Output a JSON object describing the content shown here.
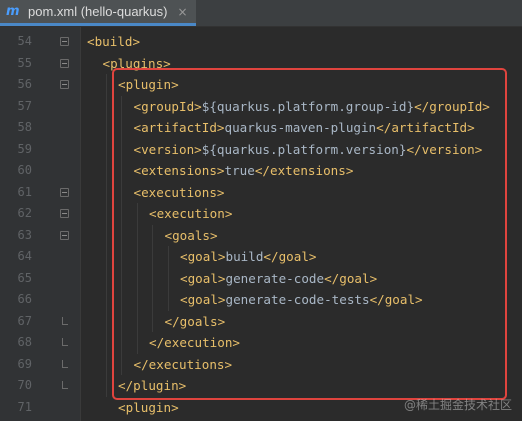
{
  "tab": {
    "icon": "maven-icon",
    "label": "pom.xml (hello-quarkus)",
    "close": "×"
  },
  "lines": [
    {
      "num": "54",
      "indent": 0,
      "parts": [
        [
          "tag",
          "<build>"
        ]
      ]
    },
    {
      "num": "55",
      "indent": 1,
      "parts": [
        [
          "tag",
          "<plugins>"
        ]
      ]
    },
    {
      "num": "56",
      "indent": 2,
      "parts": [
        [
          "tag",
          "<plugin>"
        ]
      ]
    },
    {
      "num": "57",
      "indent": 3,
      "parts": [
        [
          "tag",
          "<groupId>"
        ],
        [
          "txt",
          "${quarkus.platform.group-id}"
        ],
        [
          "tag",
          "</groupId>"
        ]
      ]
    },
    {
      "num": "58",
      "indent": 3,
      "parts": [
        [
          "tag",
          "<artifactId>"
        ],
        [
          "txt",
          "quarkus-maven-plugin"
        ],
        [
          "tag",
          "</artifactId>"
        ]
      ]
    },
    {
      "num": "59",
      "indent": 3,
      "parts": [
        [
          "tag",
          "<version>"
        ],
        [
          "txt",
          "${quarkus.platform.version}"
        ],
        [
          "tag",
          "</version>"
        ]
      ]
    },
    {
      "num": "60",
      "indent": 3,
      "parts": [
        [
          "tag",
          "<extensions>"
        ],
        [
          "txt",
          "true"
        ],
        [
          "tag",
          "</extensions>"
        ]
      ]
    },
    {
      "num": "61",
      "indent": 3,
      "parts": [
        [
          "tag",
          "<executions>"
        ]
      ]
    },
    {
      "num": "62",
      "indent": 4,
      "parts": [
        [
          "tag",
          "<execution>"
        ]
      ]
    },
    {
      "num": "63",
      "indent": 5,
      "parts": [
        [
          "tag",
          "<goals>"
        ]
      ]
    },
    {
      "num": "64",
      "indent": 6,
      "parts": [
        [
          "tag",
          "<goal>"
        ],
        [
          "txt",
          "build"
        ],
        [
          "tag",
          "</goal>"
        ]
      ]
    },
    {
      "num": "65",
      "indent": 6,
      "parts": [
        [
          "tag",
          "<goal>"
        ],
        [
          "txt",
          "generate-code"
        ],
        [
          "tag",
          "</goal>"
        ]
      ]
    },
    {
      "num": "66",
      "indent": 6,
      "parts": [
        [
          "tag",
          "<goal>"
        ],
        [
          "txt",
          "generate-code-tests"
        ],
        [
          "tag",
          "</goal>"
        ]
      ]
    },
    {
      "num": "67",
      "indent": 5,
      "parts": [
        [
          "tag",
          "</goals>"
        ]
      ]
    },
    {
      "num": "68",
      "indent": 4,
      "parts": [
        [
          "tag",
          "</execution>"
        ]
      ]
    },
    {
      "num": "69",
      "indent": 3,
      "parts": [
        [
          "tag",
          "</executions>"
        ]
      ]
    },
    {
      "num": "70",
      "indent": 2,
      "parts": [
        [
          "tag",
          "</plugin>"
        ]
      ]
    },
    {
      "num": "71",
      "indent": 2,
      "parts": [
        [
          "tag",
          "<plugin>"
        ]
      ]
    }
  ],
  "folds": {
    "open": [
      "54",
      "55",
      "56",
      "61",
      "62",
      "63"
    ],
    "close": [
      "67",
      "68",
      "69",
      "70"
    ]
  },
  "watermark": "@稀土掘金技术社区",
  "colors": {
    "tag": "#e8bf6a",
    "text": "#a9b7c6",
    "highlight": "#e0443e",
    "background": "#2b2b2b"
  }
}
